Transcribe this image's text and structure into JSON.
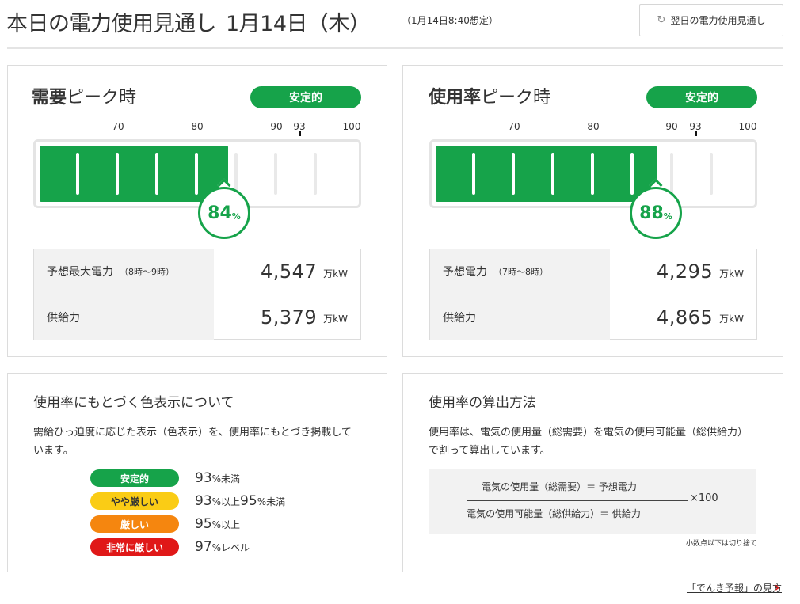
{
  "header": {
    "title": "本日の電力使用見通し",
    "date": "1月14日（木）",
    "subtitle": "（1月14日8:40想定）",
    "next_button_label": "翌日の電力使用見通し",
    "next_button_icon": "refresh-icon"
  },
  "demand_panel": {
    "title_bold": "需要",
    "title_rest": "ピーク時",
    "status": "安定的",
    "scale": [
      "70",
      "80",
      "90",
      "93",
      "100"
    ],
    "percent": "84",
    "percent_unit": "%",
    "value": 84,
    "rows": [
      {
        "label": "予想最大電力",
        "sub": "（8時～9時）",
        "value": "4,547",
        "unit": "万kW"
      },
      {
        "label": "供給力",
        "sub": "",
        "value": "5,379",
        "unit": "万kW"
      }
    ]
  },
  "usage_panel": {
    "title_bold": "使用率",
    "title_rest": "ピーク時",
    "status": "安定的",
    "scale": [
      "70",
      "80",
      "90",
      "93",
      "100"
    ],
    "percent": "88",
    "percent_unit": "%",
    "value": 88,
    "rows": [
      {
        "label": "予想電力",
        "sub": "（7時～8時）",
        "value": "4,295",
        "unit": "万kW"
      },
      {
        "label": "供給力",
        "sub": "",
        "value": "4,865",
        "unit": "万kW"
      }
    ]
  },
  "color_legend": {
    "title": "使用率にもとづく色表示について",
    "description": "需給ひっ迫度に応じた表示（色表示）を、使用率にもとづき掲載しています。",
    "items": [
      {
        "label": "安定的",
        "n1": "93",
        "t1": "%未満",
        "n2": "",
        "t2": "",
        "color": "#16a34a",
        "text_color": "#ffffff"
      },
      {
        "label": "やや厳しい",
        "n1": "93",
        "t1": "%以上",
        "n2": "95",
        "t2": "%未満",
        "color": "#facc15",
        "text_color": "#333333"
      },
      {
        "label": "厳しい",
        "n1": "95",
        "t1": "%以上",
        "n2": "",
        "t2": "",
        "color": "#f5860f",
        "text_color": "#ffffff"
      },
      {
        "label": "非常に厳しい",
        "n1": "97",
        "t1": "%レベル",
        "n2": "",
        "t2": "",
        "color": "#e01818",
        "text_color": "#ffffff"
      }
    ]
  },
  "calc_method": {
    "title": "使用率の算出方法",
    "description": "使用率は、電気の使用量（総需要）を電気の使用可能量（総供給力）で割って算出しています。",
    "numerator": "電気の使用量（総需要）＝ 予想電力",
    "denominator": "電気の使用可能量（総供給力）＝ 供給力",
    "multiplier": "×100",
    "note": "小数点以下は切り捨て"
  },
  "footer": {
    "link_label": "「でんき予報」の見方",
    "arrow_icon": "chevron-right-icon"
  }
}
